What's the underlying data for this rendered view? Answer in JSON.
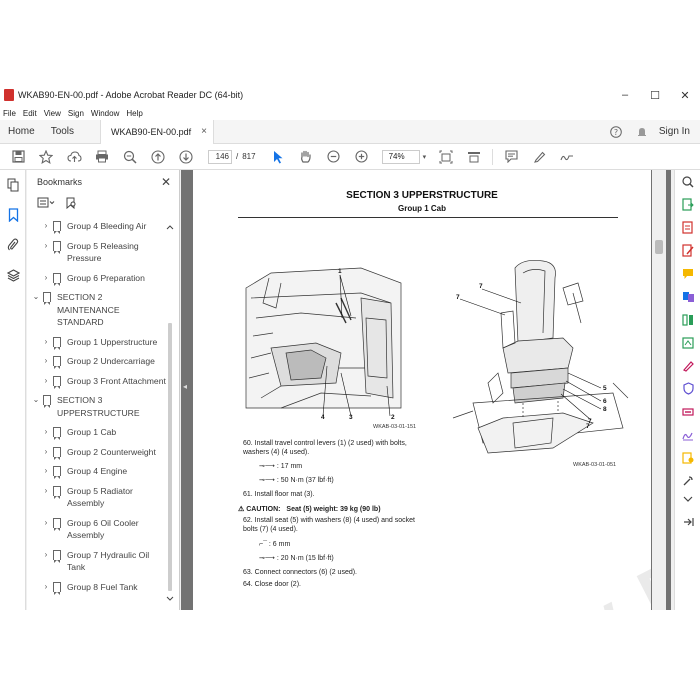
{
  "window": {
    "title": "WKAB90-EN-00.pdf - Adobe Acrobat Reader DC (64-bit)",
    "minimize": "–",
    "maximize": "☐",
    "close": "✕"
  },
  "menu": [
    "File",
    "Edit",
    "View",
    "Sign",
    "Window",
    "Help"
  ],
  "tabs": {
    "home": "Home",
    "tools": "Tools",
    "document": "WKAB90-EN-00.pdf",
    "doc_close": "×",
    "help": "?",
    "sign_in": "Sign In"
  },
  "toolbar": {
    "current_page": "146",
    "page_separator": "/",
    "total_pages": "817",
    "zoom": "74%"
  },
  "bookmarks": {
    "title": "Bookmarks",
    "close": "✕",
    "items": [
      {
        "label": "Group 4 Bleeding Air",
        "level": 1,
        "chev": "›"
      },
      {
        "label": "Group 5 Releasing Pressure",
        "level": 1,
        "chev": "›"
      },
      {
        "label": "Group 6 Preparation",
        "level": 1,
        "chev": "›"
      },
      {
        "label": "SECTION 2 MAINTENANCE STANDARD",
        "level": 0,
        "chev": "⌄"
      },
      {
        "label": "Group 1 Upperstructure",
        "level": 1,
        "chev": "›"
      },
      {
        "label": "Group 2 Undercarriage",
        "level": 1,
        "chev": "›"
      },
      {
        "label": "Group 3 Front Attachment",
        "level": 1,
        "chev": "›"
      },
      {
        "label": "SECTION 3 UPPERSTRUCTURE",
        "level": 0,
        "chev": "⌄"
      },
      {
        "label": "Group 1 Cab",
        "level": 1,
        "chev": "›"
      },
      {
        "label": "Group 2 Counterweight",
        "level": 1,
        "chev": "›"
      },
      {
        "label": "Group 4 Engine",
        "level": 1,
        "chev": "›"
      },
      {
        "label": "Group 5 Radiator Assembly",
        "level": 1,
        "chev": "›"
      },
      {
        "label": "Group 6 Oil Cooler Assembly",
        "level": 1,
        "chev": "›"
      },
      {
        "label": "Group 7 Hydraulic Oil Tank",
        "level": 1,
        "chev": "›"
      },
      {
        "label": "Group 8 Fuel Tank",
        "level": 1,
        "chev": "›"
      }
    ]
  },
  "page": {
    "section": "SECTION 3 UPPERSTRUCTURE",
    "group": "Group 1 Cab",
    "fig1_code": "WKAB-03-01-151",
    "fig2_code": "WKAB-03-01-051",
    "fig1_callouts": [
      "1",
      "2",
      "3",
      "4"
    ],
    "fig2_callouts": [
      "7",
      "7",
      "7",
      "5",
      "6",
      "8",
      "7"
    ],
    "step60": "60.  Install travel control levers (1) (2 used) with bolts, washers (4) (4 used).",
    "step60_tool": ": 17 mm",
    "step60_torque": ": 50 N·m (37 lbf·ft)",
    "step61": "61.  Install floor mat (3).",
    "caution_label": "CAUTION:",
    "caution_text": "Seat (5) weight: 39 kg (90 lb)",
    "step62": "62.  Install seat (5) with washers (8) (4 used) and socket bolts (7) (4 used).",
    "step62_tool": ": 6 mm",
    "step62_torque": ": 20 N·m (15 lbf·ft)",
    "step63": "63.  Connect connectors (6) (2 used).",
    "step64": "64.  Close door (2).",
    "watermark": "www.EPCDEPO.COM"
  }
}
